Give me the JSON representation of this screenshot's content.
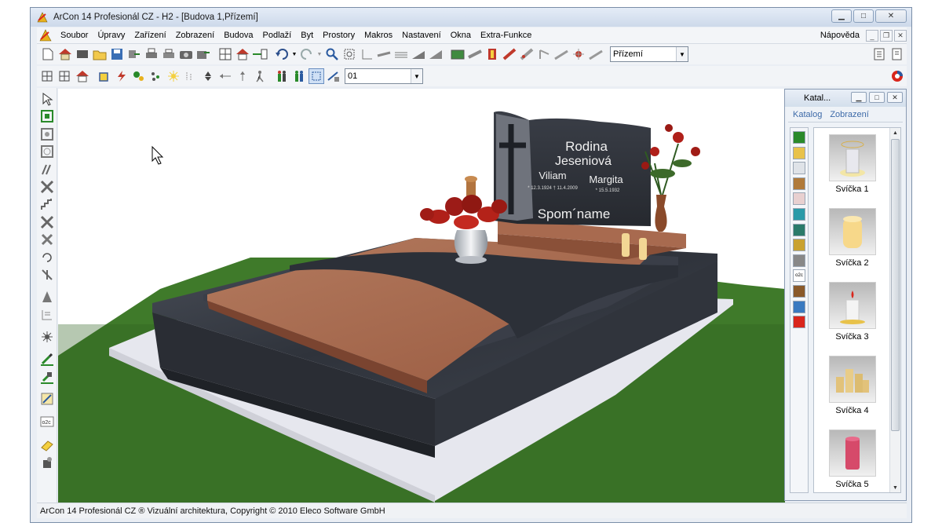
{
  "window": {
    "title": "ArCon 14 Profesionál CZ - H2 - [Budova 1,Přízemí]",
    "controls": [
      "minimize",
      "maximize",
      "close"
    ]
  },
  "menu": {
    "items": [
      "Soubor",
      "Úpravy",
      "Zařízení",
      "Zobrazení",
      "Budova",
      "Podlaží",
      "Byt",
      "Prostory",
      "Makros",
      "Nastavení",
      "Okna",
      "Extra-Funkce"
    ],
    "help": "Nápověda"
  },
  "toolbar": {
    "floor_select": "Přízemí",
    "layer_select": "01"
  },
  "scene": {
    "headstone_family": "Rodina",
    "headstone_surname": "Jeseniová",
    "name_left": "Viliam",
    "name_right": "Margita",
    "dates_left": "* 12.3.1924 † 11.4.2009",
    "dates_right": "* 15.5.1932",
    "plaque": "Spom´name",
    "colors": {
      "grass": "#3f7a2a",
      "granite_dark": "#3b3f48",
      "granite_red": "#a4694e",
      "base_white": "#e6e7ee"
    }
  },
  "catalog": {
    "title": "Katal...",
    "tabs": [
      "Katalog",
      "Zobrazení"
    ],
    "items": [
      {
        "label": "Svíčka 1"
      },
      {
        "label": "Svíčka 2"
      },
      {
        "label": "Svíčka 3"
      },
      {
        "label": "Svíčka 4"
      },
      {
        "label": "Svíčka 5"
      }
    ]
  },
  "status": {
    "text": "ArCon 14 Profesionál CZ ® Vizuální architektura, Copyright © 2010 Eleco Software GmbH"
  }
}
